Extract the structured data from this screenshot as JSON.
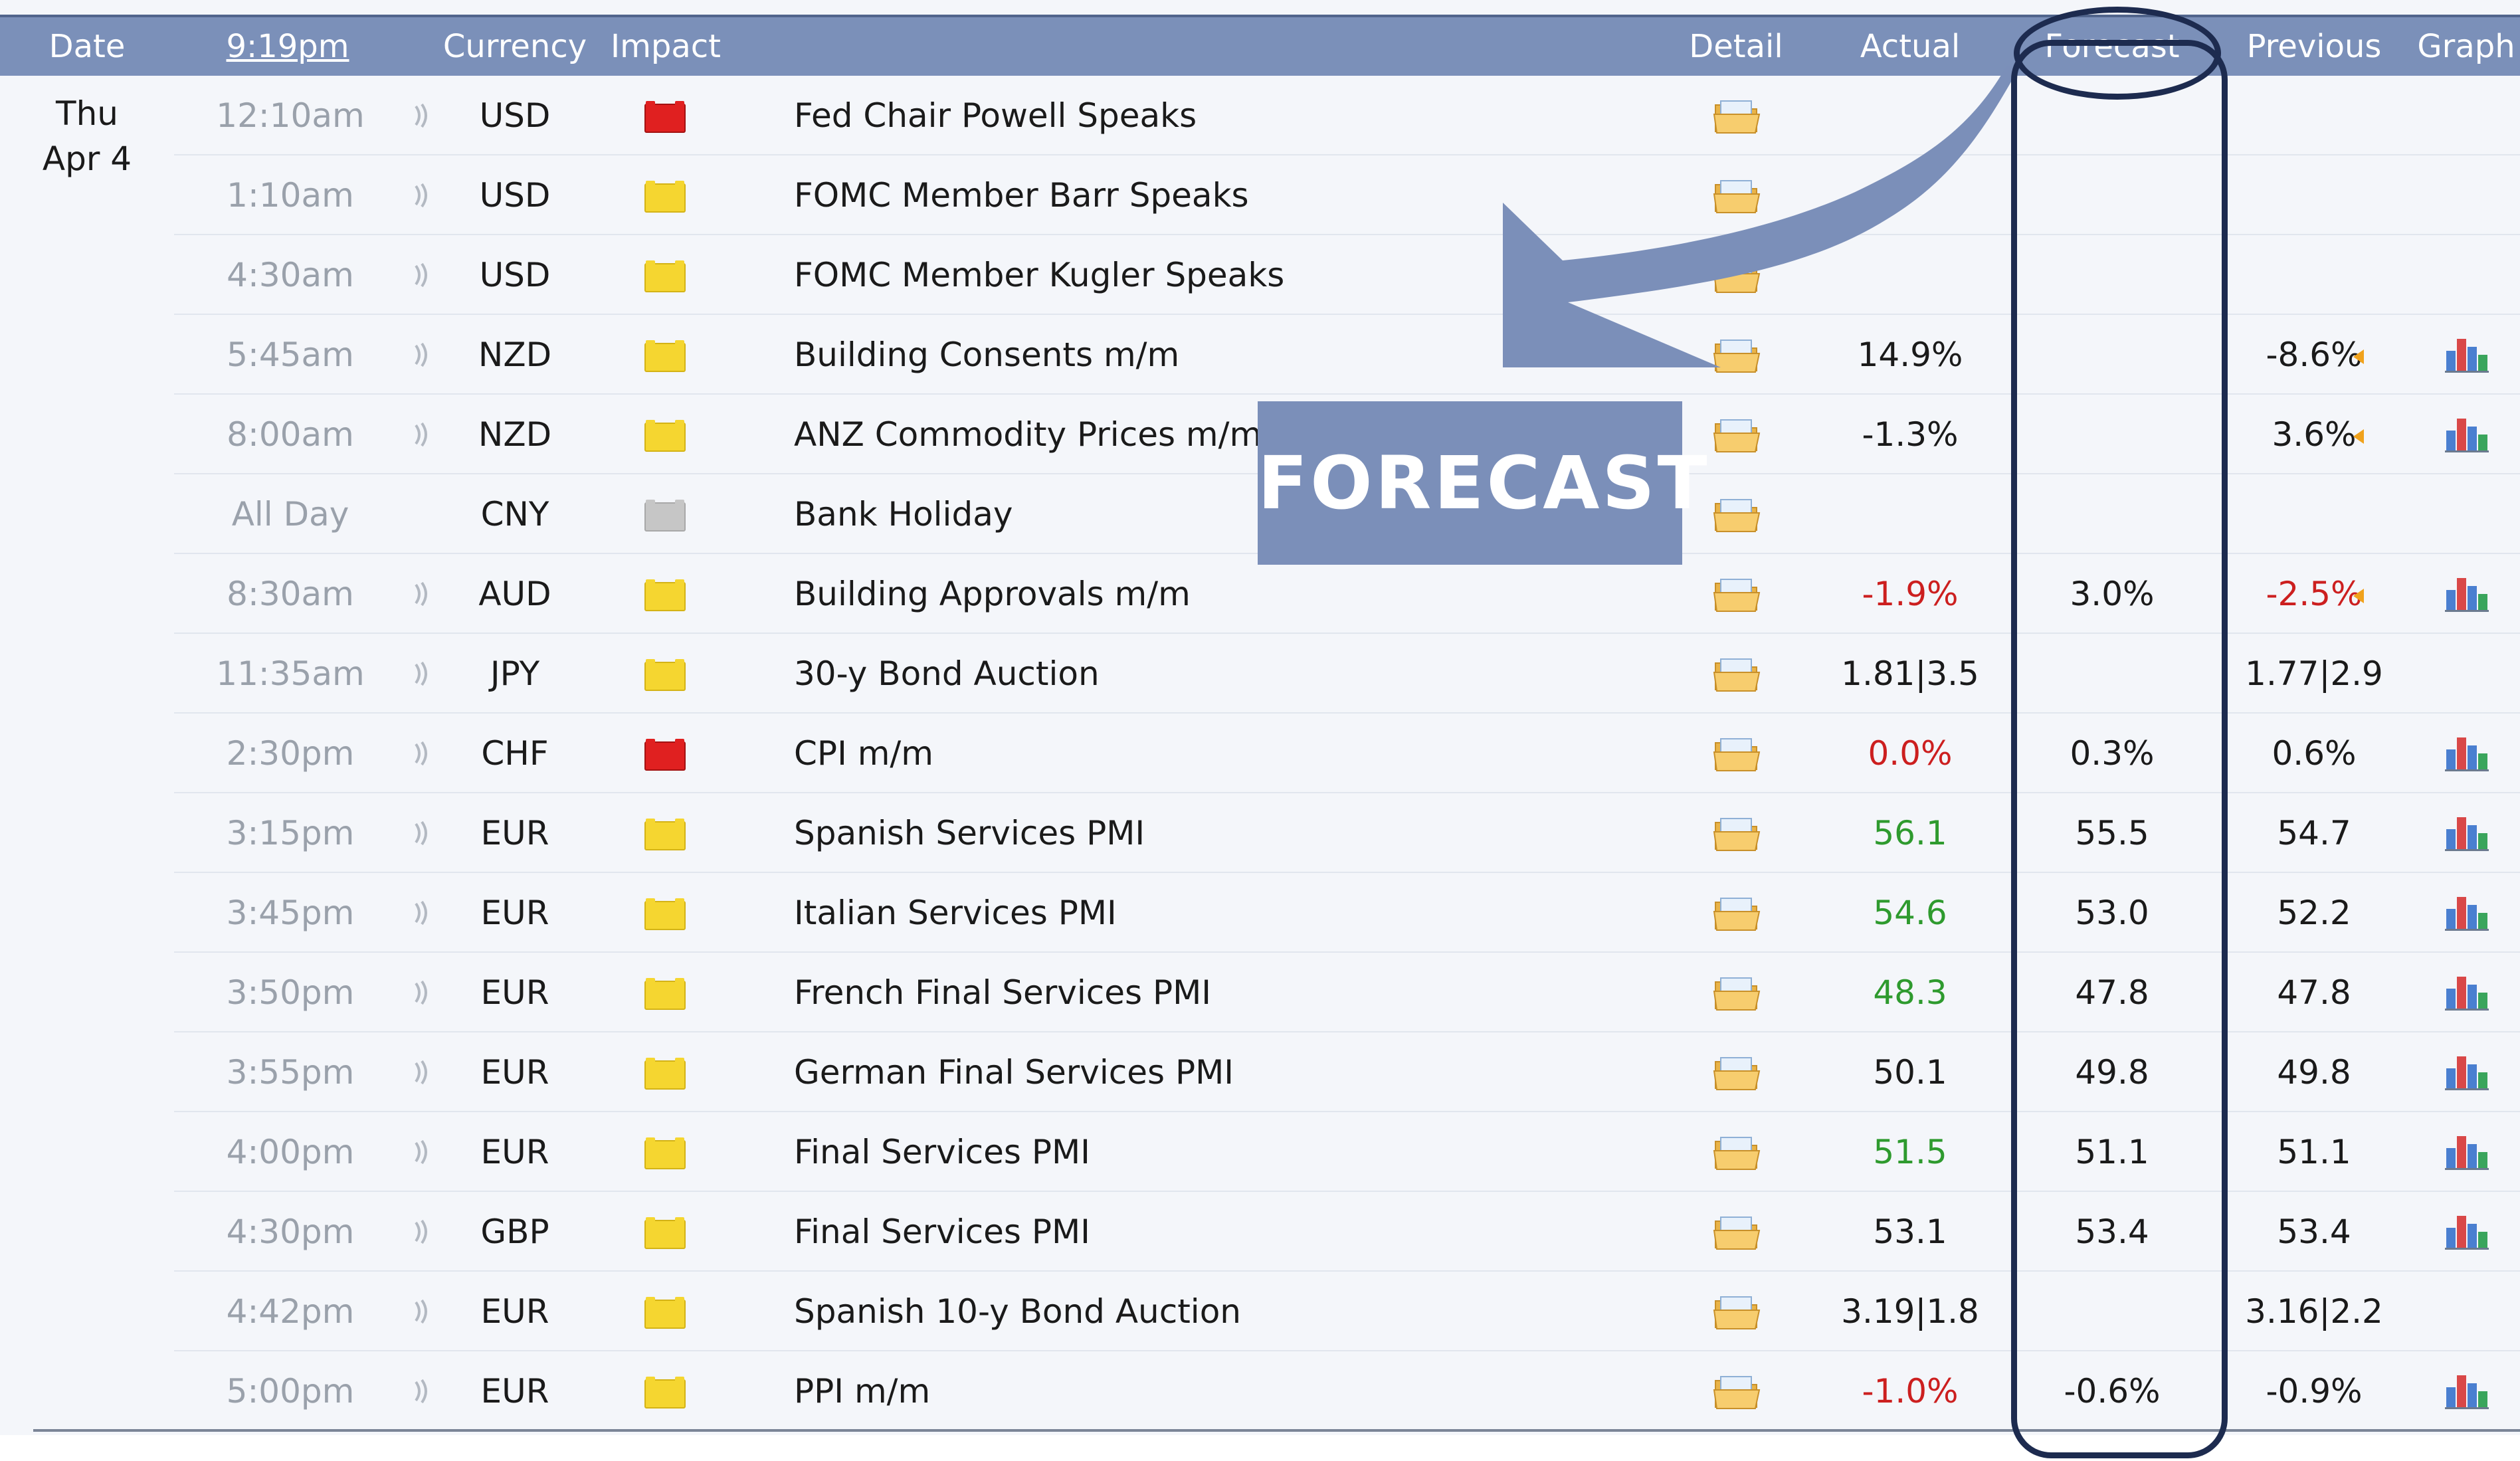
{
  "header": {
    "date_label": "Date",
    "time_label": "9:19pm",
    "currency_label": "Currency",
    "impact_label": "Impact",
    "detail_label": "Detail",
    "actual_label": "Actual",
    "forecast_label": "Forecast",
    "previous_label": "Previous",
    "graph_label": "Graph"
  },
  "date": {
    "day": "Thu",
    "month": "Apr 4"
  },
  "colors": {
    "header_bg": "#7b90b9",
    "impact_high": "#e02020",
    "impact_medium": "#f5d630",
    "impact_low": "#c6c6c6",
    "better": "#2e9a2e",
    "worse": "#cc1f1f",
    "annotation": "#1d2b4f",
    "annotation_fill": "#7b8fb9"
  },
  "annotation": {
    "label": "FORECAST"
  },
  "events": [
    {
      "time": "12:10am",
      "currency": "USD",
      "impact": "high",
      "event": "Fed Chair Powell Speaks",
      "actual": "",
      "actual_color": "neutral",
      "forecast": "",
      "previous": "",
      "prev_arrow": false,
      "graph": false
    },
    {
      "time": "1:10am",
      "currency": "USD",
      "impact": "medium",
      "event": "FOMC Member Barr Speaks",
      "actual": "",
      "actual_color": "neutral",
      "forecast": "",
      "previous": "",
      "prev_arrow": false,
      "graph": false
    },
    {
      "time": "4:30am",
      "currency": "USD",
      "impact": "medium",
      "event": "FOMC Member Kugler Speaks",
      "actual": "",
      "actual_color": "neutral",
      "forecast": "",
      "previous": "",
      "prev_arrow": false,
      "graph": false
    },
    {
      "time": "5:45am",
      "currency": "NZD",
      "impact": "medium",
      "event": "Building Consents m/m",
      "actual": "14.9%",
      "actual_color": "neutral",
      "forecast": "",
      "previous": "-8.6%",
      "prev_arrow": true,
      "graph": true
    },
    {
      "time": "8:00am",
      "currency": "NZD",
      "impact": "medium",
      "event": "ANZ Commodity Prices m/m",
      "actual": "-1.3%",
      "actual_color": "neutral",
      "forecast": "",
      "previous": "3.6%",
      "prev_arrow": true,
      "graph": true
    },
    {
      "time": "All Day",
      "currency": "CNY",
      "impact": "low",
      "event": "Bank Holiday",
      "actual": "",
      "actual_color": "neutral",
      "forecast": "",
      "previous": "",
      "prev_arrow": false,
      "graph": false
    },
    {
      "time": "8:30am",
      "currency": "AUD",
      "impact": "medium",
      "event": "Building Approvals m/m",
      "actual": "-1.9%",
      "actual_color": "worse",
      "forecast": "3.0%",
      "previous": "-2.5%",
      "prev_arrow": true,
      "prev_color": "worse",
      "graph": true
    },
    {
      "time": "11:35am",
      "currency": "JPY",
      "impact": "medium",
      "event": "30-y Bond Auction",
      "actual": "1.81|3.5",
      "actual_color": "neutral",
      "forecast": "",
      "previous": "1.77|2.9",
      "prev_arrow": false,
      "graph": false
    },
    {
      "time": "2:30pm",
      "currency": "CHF",
      "impact": "high",
      "event": "CPI m/m",
      "actual": "0.0%",
      "actual_color": "worse",
      "forecast": "0.3%",
      "previous": "0.6%",
      "prev_arrow": false,
      "graph": true
    },
    {
      "time": "3:15pm",
      "currency": "EUR",
      "impact": "medium",
      "event": "Spanish Services PMI",
      "actual": "56.1",
      "actual_color": "better",
      "forecast": "55.5",
      "previous": "54.7",
      "prev_arrow": false,
      "graph": true
    },
    {
      "time": "3:45pm",
      "currency": "EUR",
      "impact": "medium",
      "event": "Italian Services PMI",
      "actual": "54.6",
      "actual_color": "better",
      "forecast": "53.0",
      "previous": "52.2",
      "prev_arrow": false,
      "graph": true
    },
    {
      "time": "3:50pm",
      "currency": "EUR",
      "impact": "medium",
      "event": "French Final Services PMI",
      "actual": "48.3",
      "actual_color": "better",
      "forecast": "47.8",
      "previous": "47.8",
      "prev_arrow": false,
      "graph": true
    },
    {
      "time": "3:55pm",
      "currency": "EUR",
      "impact": "medium",
      "event": "German Final Services PMI",
      "actual": "50.1",
      "actual_color": "neutral",
      "forecast": "49.8",
      "previous": "49.8",
      "prev_arrow": false,
      "graph": true
    },
    {
      "time": "4:00pm",
      "currency": "EUR",
      "impact": "medium",
      "event": "Final Services PMI",
      "actual": "51.5",
      "actual_color": "better",
      "forecast": "51.1",
      "previous": "51.1",
      "prev_arrow": false,
      "graph": true
    },
    {
      "time": "4:30pm",
      "currency": "GBP",
      "impact": "medium",
      "event": "Final Services PMI",
      "actual": "53.1",
      "actual_color": "neutral",
      "forecast": "53.4",
      "previous": "53.4",
      "prev_arrow": false,
      "graph": true
    },
    {
      "time": "4:42pm",
      "currency": "EUR",
      "impact": "medium",
      "event": "Spanish 10-y Bond Auction",
      "actual": "3.19|1.8",
      "actual_color": "neutral",
      "forecast": "",
      "previous": "3.16|2.2",
      "prev_arrow": false,
      "graph": false
    },
    {
      "time": "5:00pm",
      "currency": "EUR",
      "impact": "medium",
      "event": "PPI m/m",
      "actual": "-1.0%",
      "actual_color": "worse",
      "forecast": "-0.6%",
      "previous": "-0.9%",
      "prev_arrow": false,
      "graph": true
    }
  ]
}
